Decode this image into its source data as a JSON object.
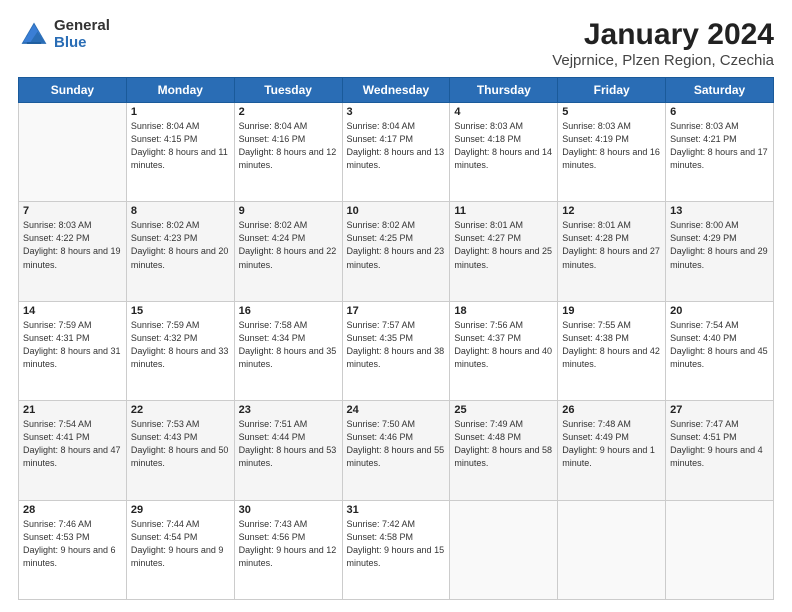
{
  "header": {
    "logo_general": "General",
    "logo_blue": "Blue",
    "title": "January 2024",
    "subtitle": "Vejprnice, Plzen Region, Czechia"
  },
  "weekdays": [
    "Sunday",
    "Monday",
    "Tuesday",
    "Wednesday",
    "Thursday",
    "Friday",
    "Saturday"
  ],
  "weeks": [
    [
      {
        "day": "",
        "sunrise": "",
        "sunset": "",
        "daylight": ""
      },
      {
        "day": "1",
        "sunrise": "Sunrise: 8:04 AM",
        "sunset": "Sunset: 4:15 PM",
        "daylight": "Daylight: 8 hours and 11 minutes."
      },
      {
        "day": "2",
        "sunrise": "Sunrise: 8:04 AM",
        "sunset": "Sunset: 4:16 PM",
        "daylight": "Daylight: 8 hours and 12 minutes."
      },
      {
        "day": "3",
        "sunrise": "Sunrise: 8:04 AM",
        "sunset": "Sunset: 4:17 PM",
        "daylight": "Daylight: 8 hours and 13 minutes."
      },
      {
        "day": "4",
        "sunrise": "Sunrise: 8:03 AM",
        "sunset": "Sunset: 4:18 PM",
        "daylight": "Daylight: 8 hours and 14 minutes."
      },
      {
        "day": "5",
        "sunrise": "Sunrise: 8:03 AM",
        "sunset": "Sunset: 4:19 PM",
        "daylight": "Daylight: 8 hours and 16 minutes."
      },
      {
        "day": "6",
        "sunrise": "Sunrise: 8:03 AM",
        "sunset": "Sunset: 4:21 PM",
        "daylight": "Daylight: 8 hours and 17 minutes."
      }
    ],
    [
      {
        "day": "7",
        "sunrise": "Sunrise: 8:03 AM",
        "sunset": "Sunset: 4:22 PM",
        "daylight": "Daylight: 8 hours and 19 minutes."
      },
      {
        "day": "8",
        "sunrise": "Sunrise: 8:02 AM",
        "sunset": "Sunset: 4:23 PM",
        "daylight": "Daylight: 8 hours and 20 minutes."
      },
      {
        "day": "9",
        "sunrise": "Sunrise: 8:02 AM",
        "sunset": "Sunset: 4:24 PM",
        "daylight": "Daylight: 8 hours and 22 minutes."
      },
      {
        "day": "10",
        "sunrise": "Sunrise: 8:02 AM",
        "sunset": "Sunset: 4:25 PM",
        "daylight": "Daylight: 8 hours and 23 minutes."
      },
      {
        "day": "11",
        "sunrise": "Sunrise: 8:01 AM",
        "sunset": "Sunset: 4:27 PM",
        "daylight": "Daylight: 8 hours and 25 minutes."
      },
      {
        "day": "12",
        "sunrise": "Sunrise: 8:01 AM",
        "sunset": "Sunset: 4:28 PM",
        "daylight": "Daylight: 8 hours and 27 minutes."
      },
      {
        "day": "13",
        "sunrise": "Sunrise: 8:00 AM",
        "sunset": "Sunset: 4:29 PM",
        "daylight": "Daylight: 8 hours and 29 minutes."
      }
    ],
    [
      {
        "day": "14",
        "sunrise": "Sunrise: 7:59 AM",
        "sunset": "Sunset: 4:31 PM",
        "daylight": "Daylight: 8 hours and 31 minutes."
      },
      {
        "day": "15",
        "sunrise": "Sunrise: 7:59 AM",
        "sunset": "Sunset: 4:32 PM",
        "daylight": "Daylight: 8 hours and 33 minutes."
      },
      {
        "day": "16",
        "sunrise": "Sunrise: 7:58 AM",
        "sunset": "Sunset: 4:34 PM",
        "daylight": "Daylight: 8 hours and 35 minutes."
      },
      {
        "day": "17",
        "sunrise": "Sunrise: 7:57 AM",
        "sunset": "Sunset: 4:35 PM",
        "daylight": "Daylight: 8 hours and 38 minutes."
      },
      {
        "day": "18",
        "sunrise": "Sunrise: 7:56 AM",
        "sunset": "Sunset: 4:37 PM",
        "daylight": "Daylight: 8 hours and 40 minutes."
      },
      {
        "day": "19",
        "sunrise": "Sunrise: 7:55 AM",
        "sunset": "Sunset: 4:38 PM",
        "daylight": "Daylight: 8 hours and 42 minutes."
      },
      {
        "day": "20",
        "sunrise": "Sunrise: 7:54 AM",
        "sunset": "Sunset: 4:40 PM",
        "daylight": "Daylight: 8 hours and 45 minutes."
      }
    ],
    [
      {
        "day": "21",
        "sunrise": "Sunrise: 7:54 AM",
        "sunset": "Sunset: 4:41 PM",
        "daylight": "Daylight: 8 hours and 47 minutes."
      },
      {
        "day": "22",
        "sunrise": "Sunrise: 7:53 AM",
        "sunset": "Sunset: 4:43 PM",
        "daylight": "Daylight: 8 hours and 50 minutes."
      },
      {
        "day": "23",
        "sunrise": "Sunrise: 7:51 AM",
        "sunset": "Sunset: 4:44 PM",
        "daylight": "Daylight: 8 hours and 53 minutes."
      },
      {
        "day": "24",
        "sunrise": "Sunrise: 7:50 AM",
        "sunset": "Sunset: 4:46 PM",
        "daylight": "Daylight: 8 hours and 55 minutes."
      },
      {
        "day": "25",
        "sunrise": "Sunrise: 7:49 AM",
        "sunset": "Sunset: 4:48 PM",
        "daylight": "Daylight: 8 hours and 58 minutes."
      },
      {
        "day": "26",
        "sunrise": "Sunrise: 7:48 AM",
        "sunset": "Sunset: 4:49 PM",
        "daylight": "Daylight: 9 hours and 1 minute."
      },
      {
        "day": "27",
        "sunrise": "Sunrise: 7:47 AM",
        "sunset": "Sunset: 4:51 PM",
        "daylight": "Daylight: 9 hours and 4 minutes."
      }
    ],
    [
      {
        "day": "28",
        "sunrise": "Sunrise: 7:46 AM",
        "sunset": "Sunset: 4:53 PM",
        "daylight": "Daylight: 9 hours and 6 minutes."
      },
      {
        "day": "29",
        "sunrise": "Sunrise: 7:44 AM",
        "sunset": "Sunset: 4:54 PM",
        "daylight": "Daylight: 9 hours and 9 minutes."
      },
      {
        "day": "30",
        "sunrise": "Sunrise: 7:43 AM",
        "sunset": "Sunset: 4:56 PM",
        "daylight": "Daylight: 9 hours and 12 minutes."
      },
      {
        "day": "31",
        "sunrise": "Sunrise: 7:42 AM",
        "sunset": "Sunset: 4:58 PM",
        "daylight": "Daylight: 9 hours and 15 minutes."
      },
      {
        "day": "",
        "sunrise": "",
        "sunset": "",
        "daylight": ""
      },
      {
        "day": "",
        "sunrise": "",
        "sunset": "",
        "daylight": ""
      },
      {
        "day": "",
        "sunrise": "",
        "sunset": "",
        "daylight": ""
      }
    ]
  ]
}
